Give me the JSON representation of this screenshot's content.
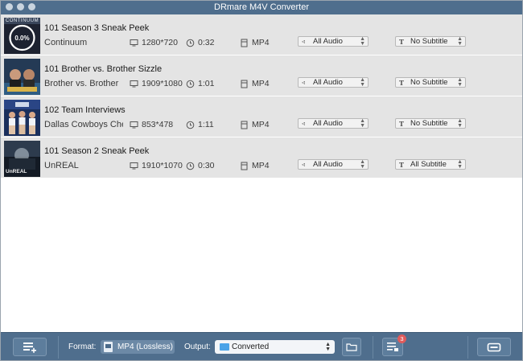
{
  "window": {
    "title": "DRmare M4V Converter"
  },
  "rows": [
    {
      "title": "101 Season 3 Sneak Peek",
      "subtitle": "Continuum",
      "resolution": "1280*720",
      "duration": "0:32",
      "format": "MP4",
      "audio": "All Audio",
      "subtitle_track": "No Subtitle",
      "thumb_text": "CONTINUUM",
      "progress": "0.0%"
    },
    {
      "title": "101 Brother vs. Brother Sizzle",
      "subtitle": "Brother vs. Brother",
      "resolution": "1909*1080",
      "duration": "1:01",
      "format": "MP4",
      "audio": "All Audio",
      "subtitle_track": "No Subtitle"
    },
    {
      "title": "102 Team Interviews",
      "subtitle": "Dallas Cowboys Chee...",
      "resolution": "853*478",
      "duration": "1:11",
      "format": "MP4",
      "audio": "All Audio",
      "subtitle_track": "No Subtitle"
    },
    {
      "title": "101 Season 2 Sneak Peek",
      "subtitle": "UnREAL",
      "resolution": "1910*1070",
      "duration": "0:30",
      "format": "MP4",
      "audio": "All Audio",
      "subtitle_track": "All Subtitle",
      "thumb_text": "UnREAL"
    }
  ],
  "toolbar": {
    "format_label": "Format:",
    "format_value": "MP4 (Lossless)",
    "output_label": "Output:",
    "output_value": "Converted",
    "history_badge": "3"
  },
  "colors": {
    "chrome": "#4f6e8d",
    "row_bg": "#e4e4e4",
    "badge": "#e05b5b",
    "folder": "#4aa3e8"
  }
}
